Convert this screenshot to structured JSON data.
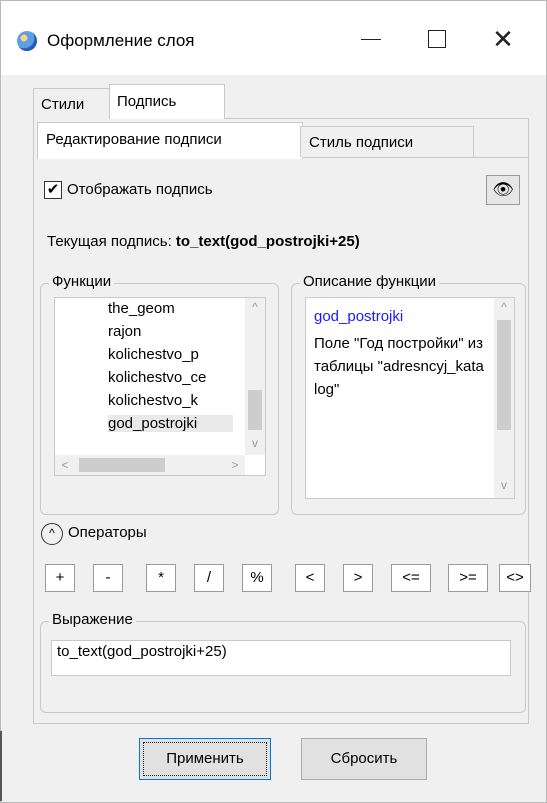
{
  "window": {
    "title": "Оформление слоя",
    "icon": "globe-icon",
    "controls": {
      "minimize": "—",
      "maximize": "☐",
      "close": "✕"
    }
  },
  "outer_tabs": [
    {
      "label": "Стили",
      "active": false
    },
    {
      "label": "Подпись",
      "active": true
    }
  ],
  "inner_tabs": [
    {
      "label": "Редактирование подписи",
      "active": true
    },
    {
      "label": "Стиль подписи",
      "active": false
    }
  ],
  "show_label": {
    "label": "Отображать подпись",
    "checked": true,
    "check": "✔"
  },
  "preview_button": {
    "icon": "eye-icon",
    "glyph": "👁"
  },
  "current_label": {
    "prefix": "Текущая подпись:",
    "value": "to_text(god_postrojki+25)"
  },
  "functions": {
    "legend": "Функции",
    "items": [
      "the_geom",
      "rajon",
      "kolichestvo_p",
      "kolichestvo_ce",
      "kolichestvo_k",
      "god_postrojki"
    ],
    "selected_index": 5
  },
  "description": {
    "legend": "Описание функции",
    "title": "god_postrojki",
    "text": "Поле \"Год постройки\" из таблицы \"adresncyj_katalog\""
  },
  "operators": {
    "label": "Операторы",
    "toggle_glyph": "^",
    "buttons": [
      "+",
      "-",
      "*",
      "/",
      "%",
      "<",
      ">",
      "<=",
      ">=",
      "<>"
    ]
  },
  "expression": {
    "legend": "Выражение",
    "value": "to_text(god_postrojki+25)"
  },
  "buttons": {
    "apply": "Применить",
    "reset": "Сбросить"
  }
}
